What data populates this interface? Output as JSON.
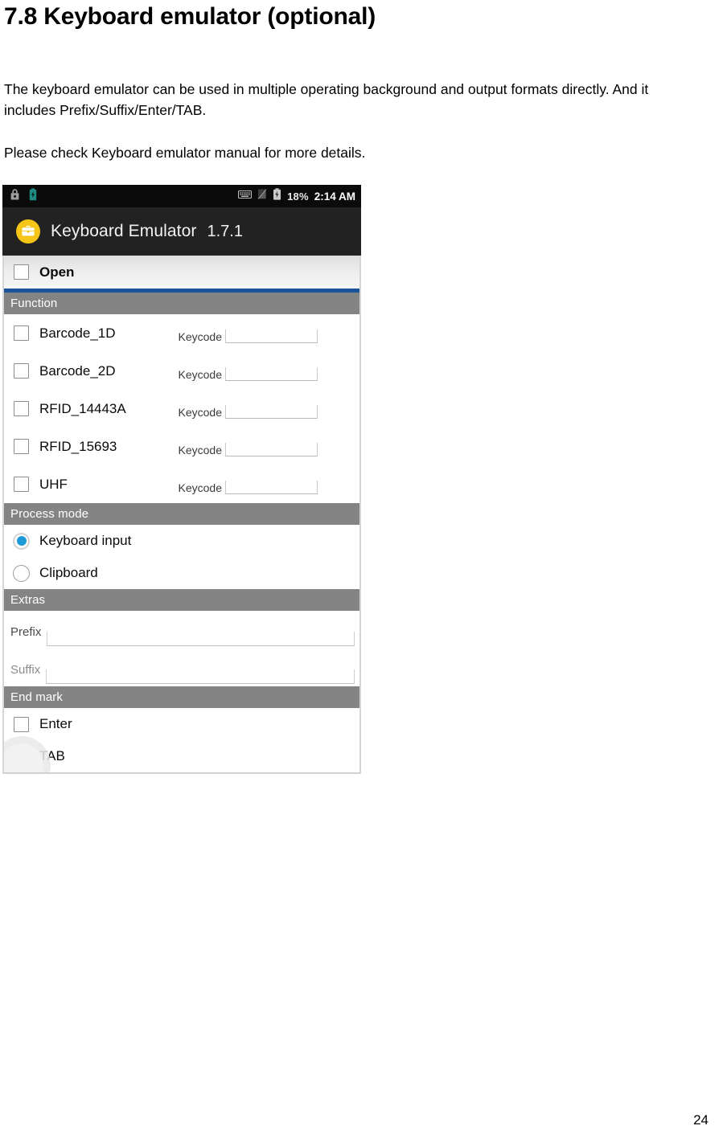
{
  "document": {
    "heading": "7.8 Keyboard emulator (optional)",
    "paragraph_1": "The keyboard emulator can be used in multiple operating background and output formats directly. And it includes Prefix/Suffix/Enter/TAB.",
    "paragraph_2": "Please check Keyboard emulator manual for more details.",
    "page_number": "24"
  },
  "screenshot": {
    "status_bar": {
      "icons_left": [
        "lock-icon",
        "battery-charging-icon"
      ],
      "icons_right": [
        "keyboard-icon",
        "no-sim-icon",
        "battery-bolt-icon"
      ],
      "battery_percent": "18%",
      "time": "2:14 AM"
    },
    "title_bar": {
      "icon": "briefcase-app-icon",
      "app_name": "Keyboard Emulator",
      "version": "1.7.1",
      "icon_color": "#f5c518"
    },
    "master_toggle": {
      "label": "Open",
      "checked": false,
      "divider_color": "#19549b"
    },
    "sections": [
      {
        "title": "Function",
        "rows": [
          {
            "label": "Barcode_1D",
            "checked": false,
            "keycode_label": "Keycode",
            "keycode_value": ""
          },
          {
            "label": "Barcode_2D",
            "checked": false,
            "keycode_label": "Keycode",
            "keycode_value": ""
          },
          {
            "label": "RFID_14443A",
            "checked": false,
            "keycode_label": "Keycode",
            "keycode_value": ""
          },
          {
            "label": "RFID_15693",
            "checked": false,
            "keycode_label": "Keycode",
            "keycode_value": ""
          },
          {
            "label": "UHF",
            "checked": false,
            "keycode_label": "Keycode",
            "keycode_value": ""
          }
        ]
      },
      {
        "title": "Process mode",
        "options": [
          {
            "label": "Keyboard input",
            "selected": true
          },
          {
            "label": "Clipboard",
            "selected": false
          }
        ],
        "selected_color": "#1e9ad6"
      },
      {
        "title": "Extras",
        "fields": [
          {
            "label": "Prefix",
            "value": ""
          },
          {
            "label": "Suffix",
            "value": ""
          }
        ]
      },
      {
        "title": "End mark",
        "rows": [
          {
            "label": "Enter",
            "checked": false
          },
          {
            "label": "TAB",
            "checked": false
          }
        ]
      }
    ]
  }
}
